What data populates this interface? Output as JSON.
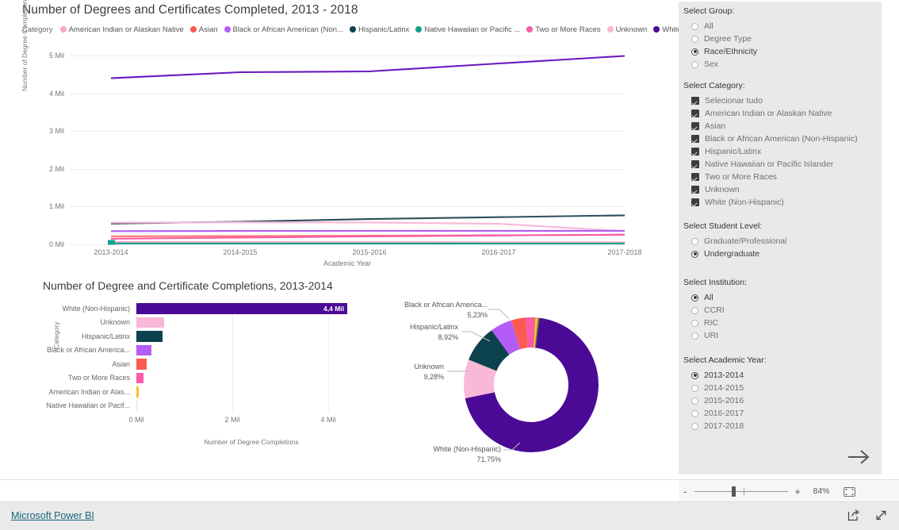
{
  "report": {
    "line_chart_title": "Number of Degrees and Certificates Completed, 2013 - 2018",
    "bar_chart_title": "Number of Degree and Certificate Completions, 2013-2014"
  },
  "legend": {
    "title": "Category",
    "items": [
      {
        "label": "American Indian or Alaskan Native",
        "color": "#F7A8C4"
      },
      {
        "label": "Asian",
        "color": "#FB5A52"
      },
      {
        "label": "Black or African American (Non...",
        "color": "#B45CF5"
      },
      {
        "label": "Hispanic/Latinx",
        "color": "#0C414E"
      },
      {
        "label": "Native Hawaiian or Pacific ...",
        "color": "#12A38F"
      },
      {
        "label": "Two or More Races",
        "color": "#FB5AA8"
      },
      {
        "label": "Unknown",
        "color": "#F9B8D8"
      },
      {
        "label": "White (Non-Hispanic)",
        "color": "#4B0A96"
      }
    ]
  },
  "chart_data": [
    {
      "type": "line",
      "title": "Number of Degrees and Certificates Completed, 2013 - 2018",
      "xlabel": "Academic Year",
      "ylabel": "Number of Degree Completions",
      "categories": [
        "2013-2014",
        "2014-2015",
        "2015-2016",
        "2016-2017",
        "2017-2018"
      ],
      "ylim": [
        0,
        5000000
      ],
      "yticks": [
        "0 Mil",
        "1 Mil",
        "2 Mil",
        "3 Mil",
        "4 Mil",
        "5 Mil"
      ],
      "grid": true,
      "legend_position": "top",
      "series": [
        {
          "name": "White (Non-Hispanic)",
          "color": "#6B17C0",
          "values": [
            4400000,
            4560000,
            4580000,
            4790000,
            5010000
          ]
        },
        {
          "name": "Hispanic/Latinx",
          "color": "#2C4F5C",
          "values": [
            550000,
            600000,
            670000,
            720000,
            770000
          ]
        },
        {
          "name": "Unknown",
          "color": "#F9B8D8",
          "values": [
            575000,
            585000,
            580000,
            545000,
            350000
          ]
        },
        {
          "name": "Black or African American (Non-Hispanic)",
          "color": "#B45CF5",
          "values": [
            350000,
            355000,
            360000,
            360000,
            360000
          ]
        },
        {
          "name": "Asian",
          "color": "#FB7A6E",
          "values": [
            215000,
            220000,
            230000,
            240000,
            252000
          ]
        },
        {
          "name": "Two or More Races",
          "color": "#FB5AA8",
          "values": [
            150000,
            180000,
            210000,
            235000,
            258000
          ]
        },
        {
          "name": "American Indian or Alaskan Native",
          "color": "#F7A8C4",
          "values": [
            60000,
            58000,
            56000,
            54000,
            52000
          ]
        },
        {
          "name": "Native Hawaiian or Pacific Islander",
          "color": "#12A38F",
          "values": [
            22000,
            22000,
            22000,
            22000,
            22000
          ]
        }
      ]
    },
    {
      "type": "bar",
      "orientation": "horizontal",
      "title": "Number of Degree and Certificate Completions, 2013-2014",
      "xlabel": "Number of Degree Completions",
      "ylabel": "Category",
      "xticks": [
        "0 Mil",
        "2 Mil",
        "4 Mil"
      ],
      "xlim": [
        0,
        4800000
      ],
      "categories": [
        "White (Non-Hispanic)",
        "Unknown",
        "Hispanic/Latinx",
        "Black or African America...",
        "Asian",
        "Two or More Races",
        "American Indian or Alas...",
        "Native Hawaiian or Pacif..."
      ],
      "values": [
        4400000,
        570000,
        548000,
        320000,
        213000,
        148000,
        40000,
        22000
      ],
      "colors": [
        "#4B0A96",
        "#F9B8D8",
        "#0C414E",
        "#B45CF5",
        "#FB5A52",
        "#FB5AA8",
        "#F5C32C",
        "#E6EDF2"
      ],
      "data_labels": [
        "4,4 Mil",
        "",
        "",
        "",
        "",
        "",
        "",
        ""
      ]
    },
    {
      "type": "pie",
      "subtype": "donut",
      "title": "",
      "labels": [
        "White (Non-Hispanic)",
        "Unknown",
        "Hispanic/Latinx",
        "Black or African America...",
        "Asian",
        "Two or More Races",
        "American Indian or Alaskan Native",
        "Native Hawaiian or Pacific Islander"
      ],
      "values": [
        71.75,
        9.28,
        8.92,
        5.23,
        3.4,
        2.4,
        0.65,
        0.37
      ],
      "display_values": [
        "71,75%",
        "9,28%",
        "8,92%",
        "5,23%",
        "",
        "",
        "",
        ""
      ],
      "colors": [
        "#4B0A96",
        "#F9B8D8",
        "#0C414E",
        "#B45CF5",
        "#FB5A52",
        "#FB5AA8",
        "#F5C32C",
        "#6F7B3A"
      ],
      "visible_labels": [
        {
          "name": "Black or African America...",
          "pct": "5,23%"
        },
        {
          "name": "Hispanic/Latinx",
          "pct": "8,92%"
        },
        {
          "name": "Unknown",
          "pct": "9,28%"
        },
        {
          "name": "White (Non-Hispanic)",
          "pct": "71,75%"
        }
      ]
    }
  ],
  "filters": {
    "group": {
      "heading": "Select Group:",
      "options": [
        "All",
        "Degree Type",
        "Race/Ethnicity",
        "Sex"
      ],
      "selected": "Race/Ethnicity"
    },
    "category": {
      "heading": "Select Category:",
      "options": [
        "Selecionar tudo",
        "American Indian or Alaskan Native",
        "Asian",
        "Black or African American (Non-Hispanic)",
        "Hispanic/Latinx",
        "Native Hawaiian or Pacific Islander",
        "Two or More Races",
        "Unknown",
        "White (Non-Hispanic)"
      ],
      "checked": [
        true,
        true,
        true,
        true,
        true,
        true,
        true,
        true,
        true
      ]
    },
    "student_level": {
      "heading": "Select Student Level:",
      "options": [
        "Graduate/Professional",
        "Undergraduate"
      ],
      "selected": "Undergraduate"
    },
    "institution": {
      "heading": "Select Institution:",
      "options": [
        "All",
        "CCRI",
        "RIC",
        "URI"
      ],
      "selected": "All"
    },
    "academic_year": {
      "heading": "Select Academic Year:",
      "options": [
        "2013-2014",
        "2014-2015",
        "2015-2016",
        "2016-2017",
        "2017-2018"
      ],
      "selected": "2013-2014"
    }
  },
  "zoom_control": {
    "minus": "-",
    "plus": "+",
    "level": "84%"
  },
  "footer": {
    "brand": "Microsoft Power BI"
  }
}
